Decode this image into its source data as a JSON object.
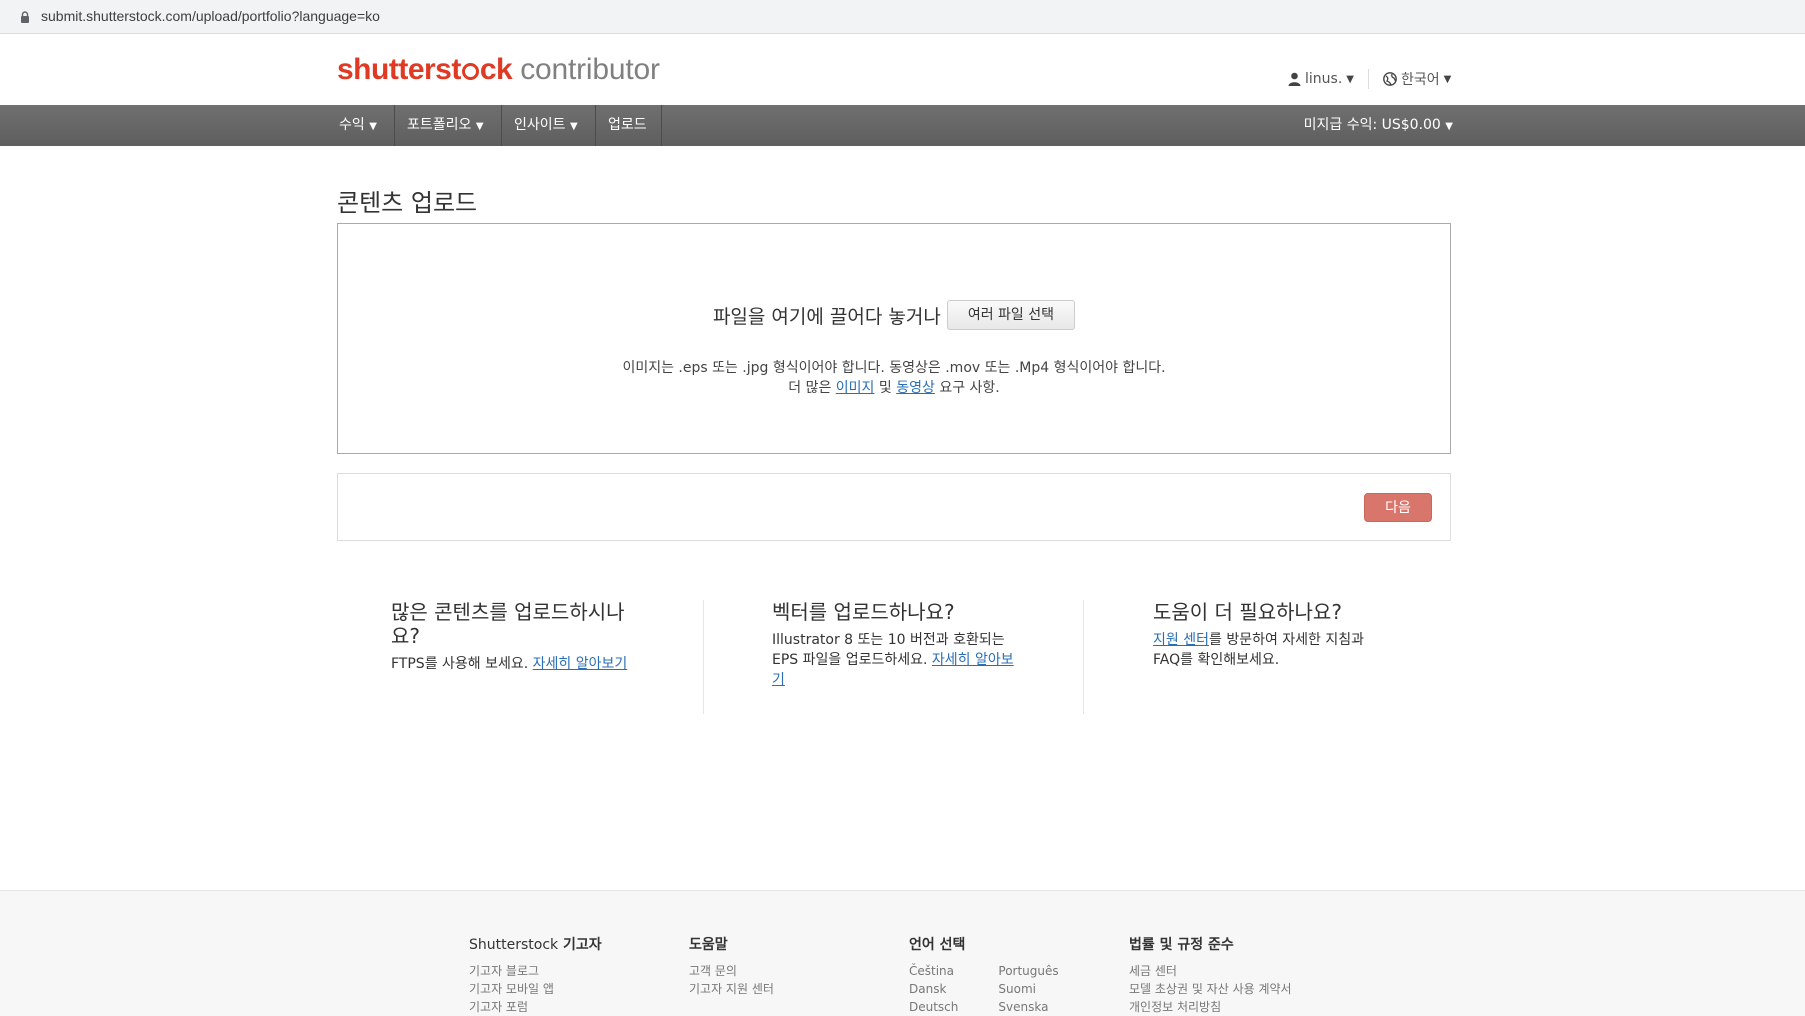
{
  "browser": {
    "url": "submit.shutterstock.com/upload/portfolio?language=ko"
  },
  "header": {
    "brand_part1": "shutterst",
    "brand_part2": "ck",
    "brand_sub": "contributor",
    "user_name": "linus.",
    "language": "한국어"
  },
  "nav": {
    "items": [
      "수익",
      "포트폴리오",
      "인사이트",
      "업로드"
    ],
    "earnings": "미지급 수익: US$0.00"
  },
  "page": {
    "title": "콘텐츠 업로드",
    "drop_text": "파일을 여기에 끌어다 놓거나",
    "select_button": "여러 파일 선택",
    "req_line1": "이미지는 .eps 또는 .jpg 형식이어야 합니다. 동영상은 .mov 또는 .Mp4 형식이어야 합니다.",
    "req_line2_prefix": "더 많은",
    "req_link_images": "이미지",
    "req_and": "및",
    "req_link_videos": "동영상",
    "req_line2_suffix": "요구 사항.",
    "next_button": "다음"
  },
  "info": {
    "bulk": {
      "title": "많은 콘텐츠를 업로드하시나요?",
      "text": "FTPS를 사용해 보세요.",
      "link": "자세히 알아보기"
    },
    "vector": {
      "title": "벡터를 업로드하나요?",
      "text": "Illustrator 8 또는 10 버전과 호환되는 EPS 파일을 업로드하세요.",
      "link": "자세히 알아보기"
    },
    "help": {
      "title": "도움이 더 필요하나요?",
      "link": "지원 센터",
      "text": "를 방문하여 자세한 지침과 FAQ를 확인해보세요."
    }
  },
  "footer": {
    "contributor": {
      "title_brand": "Shutterstock",
      "title_rest": "기고자",
      "links": [
        "기고자 블로그",
        "기고자 모바일 앱",
        "기고자 포럼"
      ]
    },
    "help": {
      "title": "도움말",
      "links": [
        "고객 문의",
        "기고자 지원 센터"
      ]
    },
    "language": {
      "title": "언어 선택",
      "col1": [
        "Čeština",
        "Dansk",
        "Deutsch"
      ],
      "col2": [
        "Português",
        "Suomi",
        "Svenska"
      ]
    },
    "legal": {
      "title": "법률 및 규정 준수",
      "links": [
        "세금 센터",
        "모델 초상권 및 자산 사용 계약서",
        "개인정보 처리방침"
      ]
    }
  }
}
